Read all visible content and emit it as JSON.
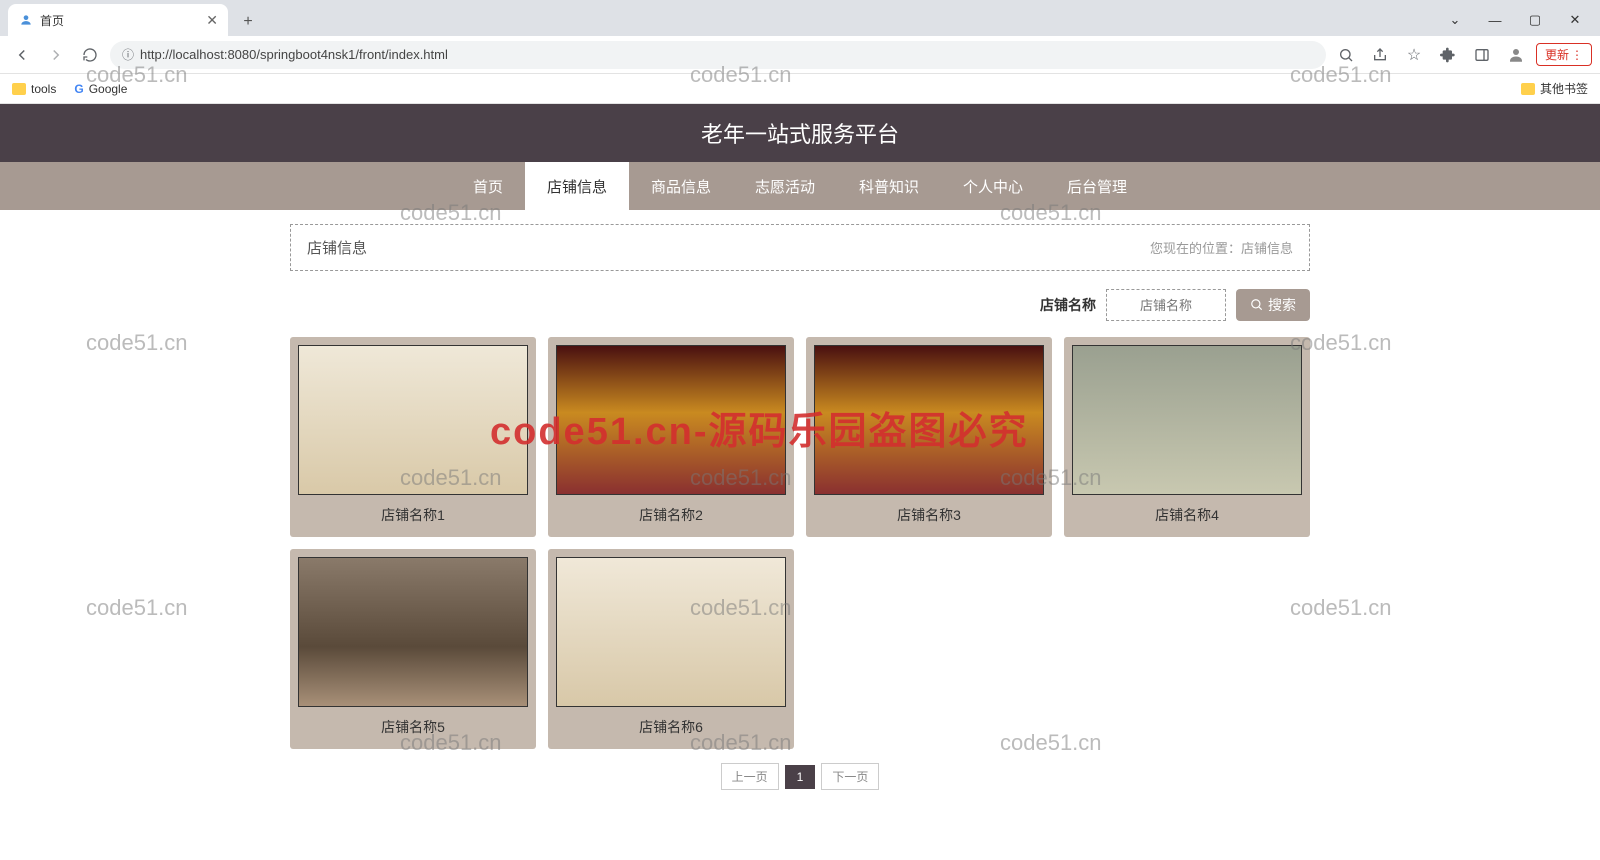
{
  "browser": {
    "tab_title": "首页",
    "new_tab": "+",
    "url_label": "ⓘ",
    "url": "http://localhost:8080/springboot4nsk1/front/index.html",
    "update_label": "更新",
    "window_controls": {
      "expand": "⌄",
      "min": "—",
      "max": "▢",
      "close": "✕"
    },
    "bookmarks": {
      "tools": "tools",
      "google": "Google",
      "other": "其他书签"
    }
  },
  "header": {
    "title": "老年一站式服务平台"
  },
  "nav": {
    "items": [
      {
        "label": "首页",
        "active": false
      },
      {
        "label": "店铺信息",
        "active": true
      },
      {
        "label": "商品信息",
        "active": false
      },
      {
        "label": "志愿活动",
        "active": false
      },
      {
        "label": "科普知识",
        "active": false
      },
      {
        "label": "个人中心",
        "active": false
      },
      {
        "label": "后台管理",
        "active": false
      }
    ]
  },
  "breadcrumb": {
    "title": "店铺信息",
    "location_label": "您现在的位置：",
    "location_value": "店铺信息"
  },
  "search": {
    "label": "店铺名称",
    "placeholder": "店铺名称",
    "button": "搜索"
  },
  "cards": [
    {
      "title": "店铺名称1",
      "cls": "store-a"
    },
    {
      "title": "店铺名称2",
      "cls": "store-b"
    },
    {
      "title": "店铺名称3",
      "cls": "store-c"
    },
    {
      "title": "店铺名称4",
      "cls": "store-d"
    },
    {
      "title": "店铺名称5",
      "cls": "store-e"
    },
    {
      "title": "店铺名称6",
      "cls": "store-f"
    }
  ],
  "pagination": {
    "prev": "上一页",
    "current": "1",
    "next": "下一页"
  },
  "watermarks": {
    "text": "code51.cn",
    "red": "code51.cn-源码乐园盗图必究"
  }
}
